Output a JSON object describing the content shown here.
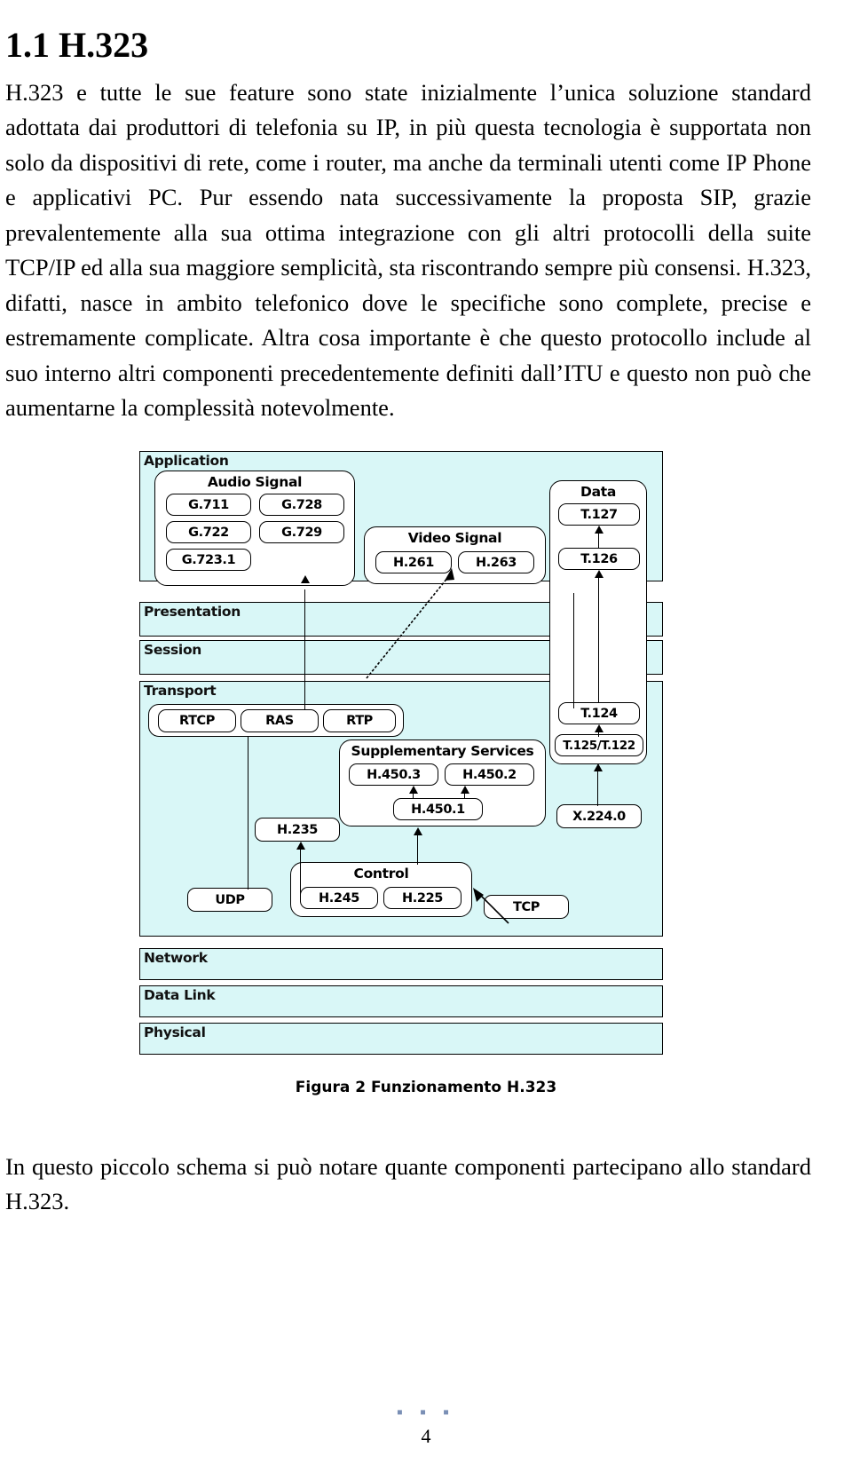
{
  "document": {
    "heading": "1.1 H.323",
    "paragraph_intro": "H.323 e tutte le sue feature sono state inizialmente l’unica soluzione standard adottata dai produttori di telefonia su IP, in più questa tecnologia è supportata non solo da dispositivi di rete, come i router, ma anche da terminali utenti come IP Phone e applicativi PC. Pur essendo nata successivamente la proposta SIP, grazie prevalentemente alla sua ottima integrazione con gli altri protocolli della suite TCP/IP ed alla sua maggiore semplicità, sta riscontrando sempre più consensi. H.323, difatti, nasce in ambito telefonico dove le specifiche sono complete, precise e estremamente complicate. Altra cosa importante è che questo protocollo include al suo interno altri componenti precedentemente definiti dall’ITU e questo non può che aumentarne la complessità notevolmente.",
    "paragraph_closing": "In questo piccolo schema si può notare quante componenti partecipano allo standard H.323.",
    "figure_caption": "Figura 2 Funzionamento H.323",
    "page_number": "4",
    "footer_dots": "▪ ▪ ▪"
  },
  "colors": {
    "layer_fill": "#d9f7f7",
    "box_fill": "#ffffff",
    "stroke": "#000000",
    "footer_dot": "#7a8fb5"
  },
  "diagram": {
    "title": "Funzionamento H.323",
    "layers": [
      {
        "name": "Application"
      },
      {
        "name": "Presentation"
      },
      {
        "name": "Session"
      },
      {
        "name": "Transport"
      },
      {
        "name": "Network"
      },
      {
        "name": "Data Link"
      },
      {
        "name": "Physical"
      }
    ],
    "groups": {
      "audio_signal": {
        "title": "Audio Signal",
        "items": [
          "G.711",
          "G.728",
          "G.722",
          "G.729",
          "G.723.1"
        ]
      },
      "video_signal": {
        "title": "Video Signal",
        "items": [
          "H.261",
          "H.263"
        ]
      },
      "data": {
        "title": "Data",
        "items": [
          "T.127",
          "T.126",
          "T.124",
          "T.125/T.122"
        ]
      },
      "supplementary_services": {
        "title": "Supplementary Services",
        "items": [
          "H.450.3",
          "H.450.2",
          "H.450.1"
        ]
      },
      "control": {
        "title": "Control",
        "items": [
          "H.245",
          "H.225"
        ]
      }
    },
    "transport_protocols": [
      "RTCP",
      "RAS",
      "RTP"
    ],
    "standalone": [
      "H.235",
      "UDP",
      "TCP",
      "X.224.0"
    ]
  }
}
